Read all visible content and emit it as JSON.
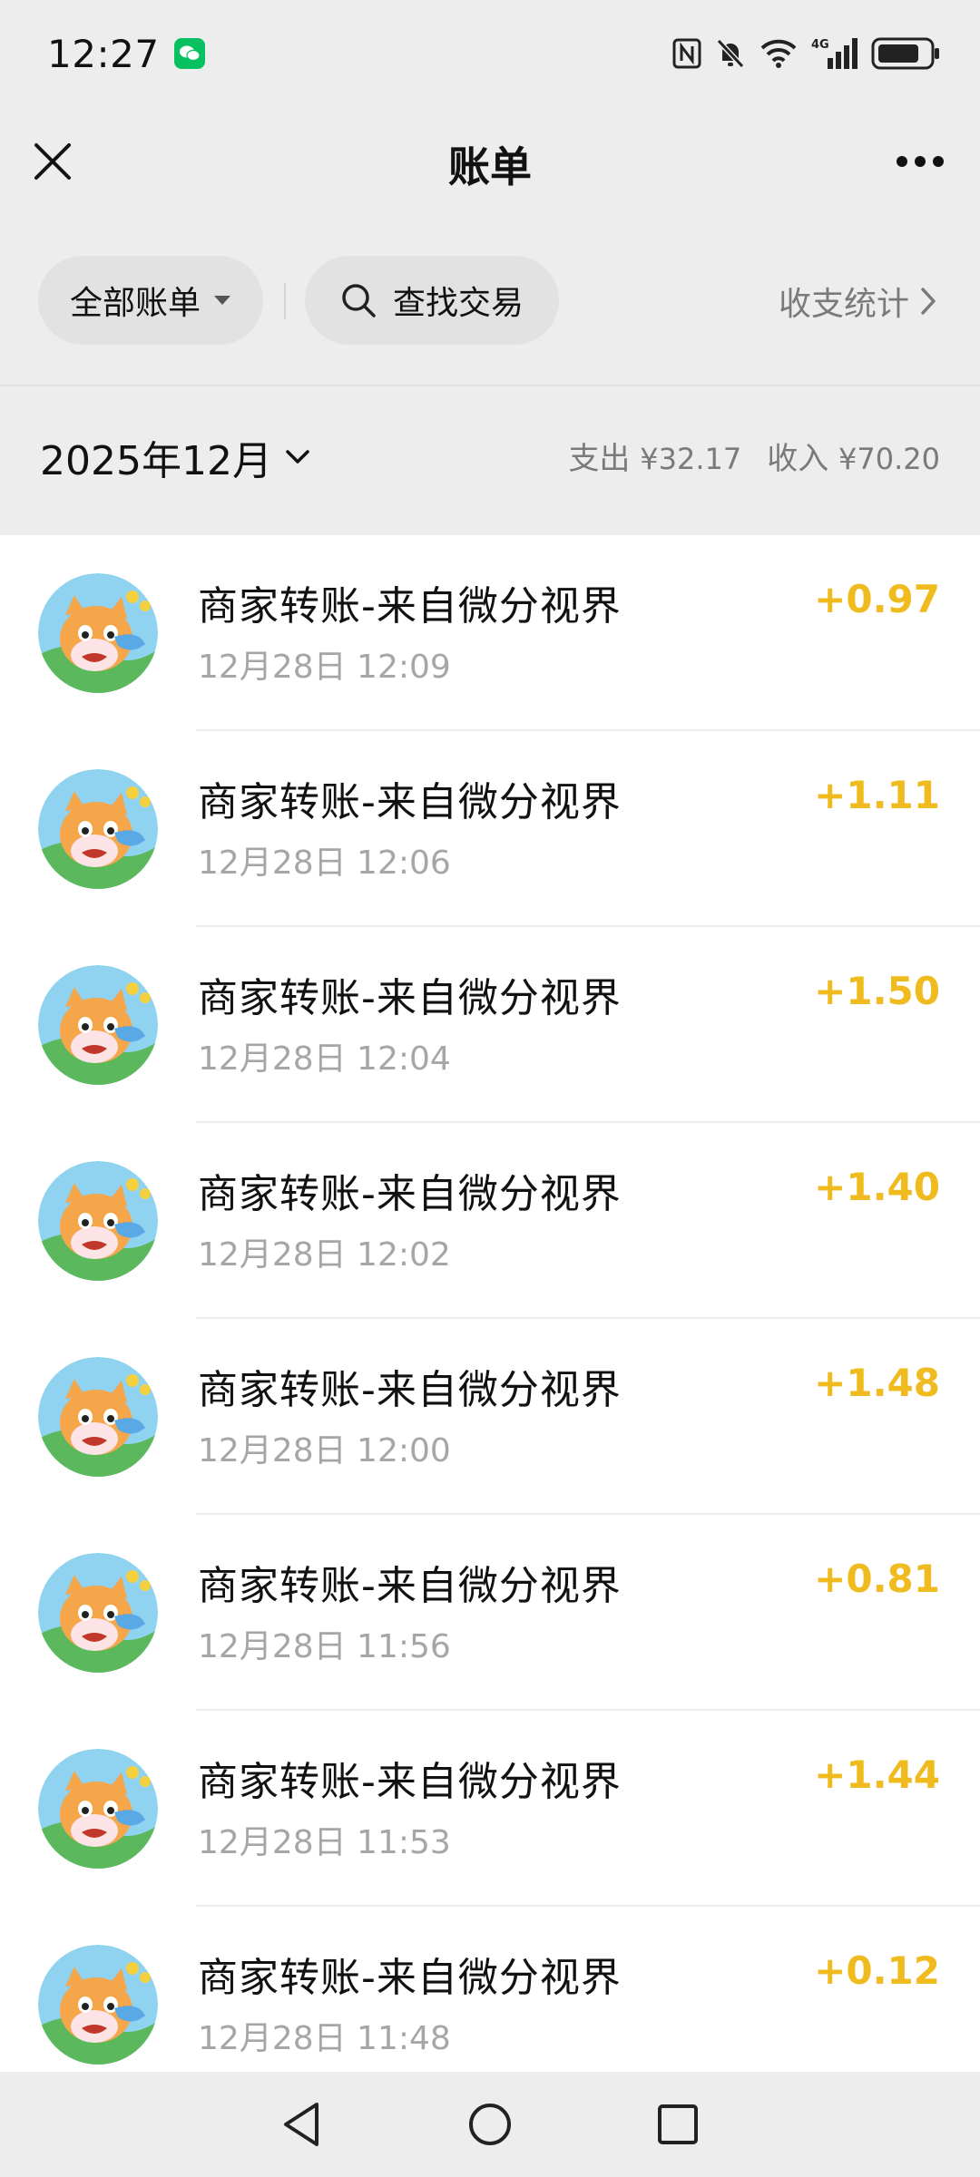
{
  "status_bar": {
    "time": "12:27",
    "app_badge_icon": "wechat-icon",
    "icons": [
      "nfc-icon",
      "mute-icon",
      "wifi-icon",
      "signal-4g-icon",
      "battery-icon"
    ],
    "network_label": "4G"
  },
  "nav": {
    "title": "账单",
    "close_icon": "close-icon",
    "more_icon": "more-icon"
  },
  "filters": {
    "all_label": "全部账单",
    "search_label": "查找交易",
    "stats_label": "收支统计"
  },
  "month": {
    "label": "2025年12月",
    "expense_label": "支出",
    "expense_amount": "¥32.17",
    "income_label": "收入",
    "income_amount": "¥70.20"
  },
  "transactions": [
    {
      "title": "商家转账-来自微分视界",
      "time": "12月28日 12:09",
      "amount": "+0.97"
    },
    {
      "title": "商家转账-来自微分视界",
      "time": "12月28日 12:06",
      "amount": "+1.11"
    },
    {
      "title": "商家转账-来自微分视界",
      "time": "12月28日 12:04",
      "amount": "+1.50"
    },
    {
      "title": "商家转账-来自微分视界",
      "time": "12月28日 12:02",
      "amount": "+1.40"
    },
    {
      "title": "商家转账-来自微分视界",
      "time": "12月28日 12:00",
      "amount": "+1.48"
    },
    {
      "title": "商家转账-来自微分视界",
      "time": "12月28日 11:56",
      "amount": "+0.81"
    },
    {
      "title": "商家转账-来自微分视界",
      "time": "12月28日 11:53",
      "amount": "+1.44"
    },
    {
      "title": "商家转账-来自微分视界",
      "time": "12月28日 11:48",
      "amount": "+0.12"
    }
  ],
  "colors": {
    "background": "#ededed",
    "income_amount": "#f0bb1f",
    "wechat_green": "#07c160"
  },
  "system_nav": [
    "back-icon",
    "home-icon",
    "recents-icon"
  ]
}
